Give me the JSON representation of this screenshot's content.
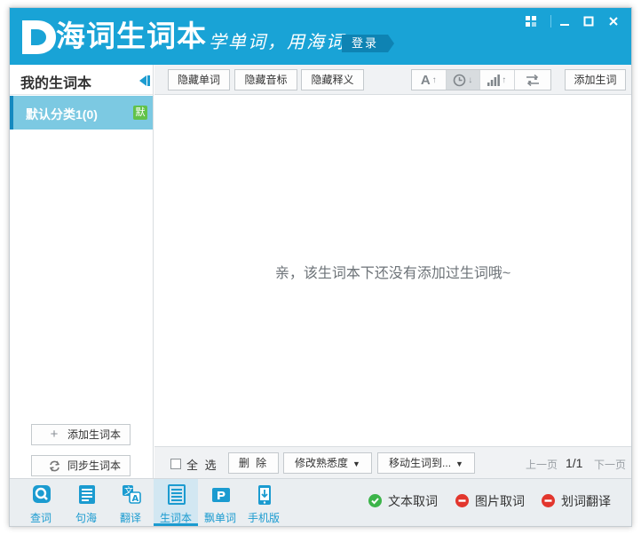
{
  "app": {
    "name": "海词生词本",
    "slogan": "学单词，用海词",
    "login_label": "登录",
    "colors": {
      "brand": "#19a3d6",
      "accent_dark": "#1589bf",
      "selection": "#7cc9e2",
      "success": "#3cb44a",
      "danger": "#e2362d"
    }
  },
  "window_controls": [
    {
      "name": "skin-icon",
      "glyph": "▚"
    },
    {
      "name": "minimize-icon",
      "glyph": "—"
    },
    {
      "name": "maximize-icon",
      "glyph": "□"
    },
    {
      "name": "close-icon",
      "glyph": "✕"
    }
  ],
  "sidebar": {
    "title": "我的生词本",
    "categories": [
      {
        "label": "默认分类1(0)",
        "badge": "默"
      }
    ],
    "add_book_label": "添加生词本",
    "sync_book_label": "同步生词本"
  },
  "toolbar": {
    "hide_word": "隐藏单词",
    "hide_phonetic": "隐藏音标",
    "hide_definition": "隐藏释义",
    "sort_buttons": [
      {
        "name": "sort-alpha",
        "icon": "letter-a-icon",
        "glyph": "A",
        "active": false
      },
      {
        "name": "sort-time",
        "icon": "clock-icon",
        "glyph": "◷",
        "active": true
      },
      {
        "name": "sort-level",
        "icon": "bars-icon",
        "glyph": "▂▄▆",
        "active": false
      },
      {
        "name": "sort-random",
        "icon": "shuffle-icon",
        "glyph": "⇄",
        "active": false
      }
    ],
    "add_word": "添加生词"
  },
  "main": {
    "empty_message": "亲，该生词本下还没有添加过生词哦~"
  },
  "actionbar": {
    "select_all": "全 选",
    "delete": "删 除",
    "change_familiarity": "修改熟悉度",
    "move_words": "移动生词到...",
    "prev_page": "上一页",
    "page_indicator": "1/1",
    "next_page": "下一页"
  },
  "bottom_nav": [
    {
      "name": "lookup",
      "label": "查词",
      "icon": "magnifier-icon",
      "active": false
    },
    {
      "name": "sentences",
      "label": "句海",
      "icon": "document-icon",
      "active": false
    },
    {
      "name": "translate",
      "label": "翻译",
      "icon": "translate-icon",
      "active": false
    },
    {
      "name": "wordbook",
      "label": "生词本",
      "icon": "list-icon",
      "active": true
    },
    {
      "name": "floating-words",
      "label": "飘单词",
      "icon": "p-card-icon",
      "active": false
    },
    {
      "name": "mobile",
      "label": "手机版",
      "icon": "phone-icon",
      "active": false
    }
  ],
  "features": [
    {
      "name": "text-capture",
      "label": "文本取词",
      "status": "on"
    },
    {
      "name": "image-capture",
      "label": "图片取词",
      "status": "off"
    },
    {
      "name": "selection-translate",
      "label": "划词翻译",
      "status": "off"
    }
  ]
}
